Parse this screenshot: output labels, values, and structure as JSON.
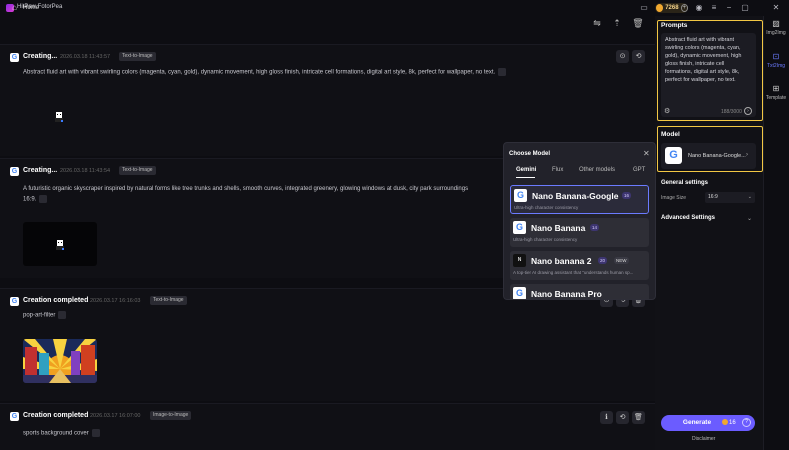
{
  "app": {
    "name": "HitPaw FotorPea",
    "credits": "7268"
  },
  "nav": {
    "home_label": "Home"
  },
  "feed": [
    {
      "title": "Creating...",
      "timestamp": "2026.03.18  11:43:57",
      "tag": "Text-to-Image",
      "prompt": "Abstract fluid art with vibrant swirling colors (magenta, cyan, gold), dynamic movement, high gloss finish, intricate cell formations, digital art style, 8k, perfect for wallpaper, no text."
    },
    {
      "title": "Creating...",
      "timestamp": "2026.03.18  11:43:54",
      "tag": "Text-to-Image",
      "prompt": "A futuristic organic skyscraper inspired by natural forms like tree trunks and shells, smooth curves, integrated greenery, glowing windows at dusk, city park surroundings",
      "prompt_line2": "16:9."
    },
    {
      "title": "Creation completed",
      "timestamp": "2026.03.17  16:16:03",
      "tag": "Text-to-Image",
      "prompt": "pop-art-filter"
    },
    {
      "title": "Creation completed",
      "timestamp": "2026.03.17  16:07:00",
      "tag": "Image-to-Image",
      "prompt": "sports background cover"
    }
  ],
  "panel": {
    "prompts_title": "Prompts",
    "prompt_text": "Abstract fluid art with vibrant swirling colors (magenta, cyan, gold), dynamic movement, high gloss finish, intricate cell formations, digital art style, 8k, perfect for wallpaper, no text.",
    "prompt_count": "188/3000",
    "model_title": "Model",
    "model_name": "Nano Banana-Google...",
    "general_settings": "General settings",
    "image_size_label": "Image Size",
    "image_size_value": "16:9",
    "advanced_settings": "Advanced Settings",
    "generate_label": "Generate",
    "generate_cost": "16",
    "disclaimer": "Disclaimer"
  },
  "rail": [
    {
      "label": "Img2Img",
      "icon": "image-icon"
    },
    {
      "label": "Txt2Img",
      "icon": "text-image-icon"
    },
    {
      "label": "Template",
      "icon": "grid-icon"
    }
  ],
  "modal": {
    "title": "Choose Model",
    "tabs": [
      "Gemini",
      "Flux",
      "Other models",
      "GPT"
    ],
    "options": [
      {
        "name": "Nano Banana-Google",
        "cost": "16",
        "desc": "Ultra-high character consistency"
      },
      {
        "name": "Nano Banana",
        "cost": "14",
        "desc": "Ultra-high character consistency"
      },
      {
        "name": "Nano banana 2",
        "cost": "20",
        "badge": "NEW",
        "desc": "A top-tier AI drawing assistant that \"understands human sp..."
      },
      {
        "name": "Nano Banana Pro",
        "cost": ""
      }
    ]
  },
  "colors": {
    "accent": "#6b5cff",
    "highlight": "#f2c744",
    "gold": "#f0a830"
  }
}
